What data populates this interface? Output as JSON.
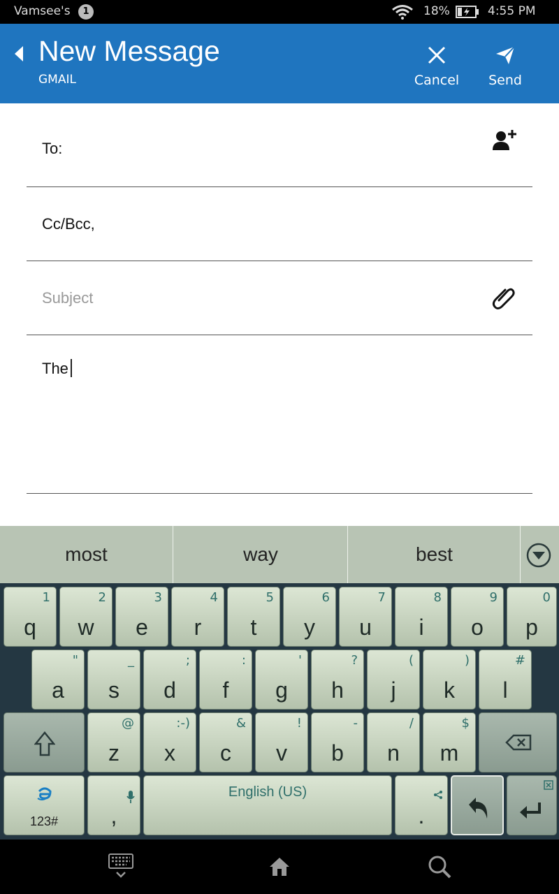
{
  "status_bar": {
    "carrier": "Vamsee's",
    "notification_count": "1",
    "battery_percent": "18%",
    "time": "4:55 PM",
    "icons": [
      "wifi-icon",
      "battery-charging-icon"
    ]
  },
  "header": {
    "title": "New Message",
    "account": "GMAIL",
    "cancel_label": "Cancel",
    "send_label": "Send",
    "color": "#1f75bf"
  },
  "compose": {
    "to_label": "To:",
    "cc_label": "Cc/Bcc,",
    "subject_placeholder": "Subject",
    "body_text": "The"
  },
  "suggestions": [
    "most",
    "way",
    "best"
  ],
  "keyboard": {
    "row1": [
      {
        "main": "q",
        "sub": "1"
      },
      {
        "main": "w",
        "sub": "2"
      },
      {
        "main": "e",
        "sub": "3"
      },
      {
        "main": "r",
        "sub": "4"
      },
      {
        "main": "t",
        "sub": "5"
      },
      {
        "main": "y",
        "sub": "6"
      },
      {
        "main": "u",
        "sub": "7"
      },
      {
        "main": "i",
        "sub": "8"
      },
      {
        "main": "o",
        "sub": "9"
      },
      {
        "main": "p",
        "sub": "0"
      }
    ],
    "row2": [
      {
        "main": "a",
        "sub": "\""
      },
      {
        "main": "s",
        "sub": "_"
      },
      {
        "main": "d",
        "sub": ";"
      },
      {
        "main": "f",
        "sub": ":"
      },
      {
        "main": "g",
        "sub": "'"
      },
      {
        "main": "h",
        "sub": "?"
      },
      {
        "main": "j",
        "sub": "("
      },
      {
        "main": "k",
        "sub": ")"
      },
      {
        "main": "l",
        "sub": "#"
      }
    ],
    "row3": [
      {
        "main": "z",
        "sub": "@"
      },
      {
        "main": "x",
        "sub": ":-)"
      },
      {
        "main": "c",
        "sub": "&"
      },
      {
        "main": "v",
        "sub": "!"
      },
      {
        "main": "b",
        "sub": "-"
      },
      {
        "main": "n",
        "sub": "/"
      },
      {
        "main": "m",
        "sub": "$"
      }
    ],
    "num_label": "123#",
    "comma_label": ",",
    "space_label": "English (US)",
    "period_label": ".",
    "key_color": "#c6d2bf",
    "background_color": "#243742"
  }
}
